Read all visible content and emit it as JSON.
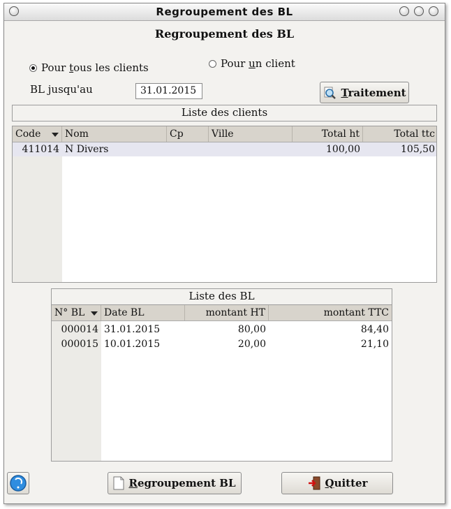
{
  "window": {
    "title": "Regroupement des BL"
  },
  "heading": "Regroupement des BL",
  "options": {
    "all_prefix": "Pour ",
    "all_mnemonic": "t",
    "all_suffix": "ous les clients",
    "one_prefix": "Pour ",
    "one_mnemonic": "u",
    "one_suffix": "n client",
    "selected": "all"
  },
  "bl_until": {
    "label": "BL jusqu'au",
    "value": "31.01.2015"
  },
  "buttons": {
    "traitement_mnemonic": "T",
    "traitement_rest": "raitement",
    "regroupement_mnemonic": "R",
    "regroupement_rest": "egroupement BL",
    "quitter_mnemonic": "Q",
    "quitter_rest": "uitter"
  },
  "clients": {
    "title": "Liste des clients",
    "columns": [
      "Code",
      "Nom",
      "Cp",
      "Ville",
      "Total ht",
      "Total ttc"
    ],
    "rows": [
      {
        "code": "411014",
        "nom": "N Divers",
        "cp": "",
        "ville": "",
        "total_ht": "100,00",
        "total_ttc": "105,50"
      }
    ]
  },
  "bls": {
    "title": "Liste des BL",
    "columns": [
      "N° BL",
      "Date BL",
      "montant HT",
      "montant TTC"
    ],
    "rows": [
      {
        "num": "000014",
        "date": "31.01.2015",
        "ht": "80,00",
        "ttc": "84,40"
      },
      {
        "num": "000015",
        "date": "10.01.2015",
        "ht": "20,00",
        "ttc": "21,10"
      }
    ]
  },
  "colors": {
    "selected_row": "#e6e6f0",
    "header_bg": "#d8d4cc",
    "window_bg": "#f3f2ef"
  }
}
